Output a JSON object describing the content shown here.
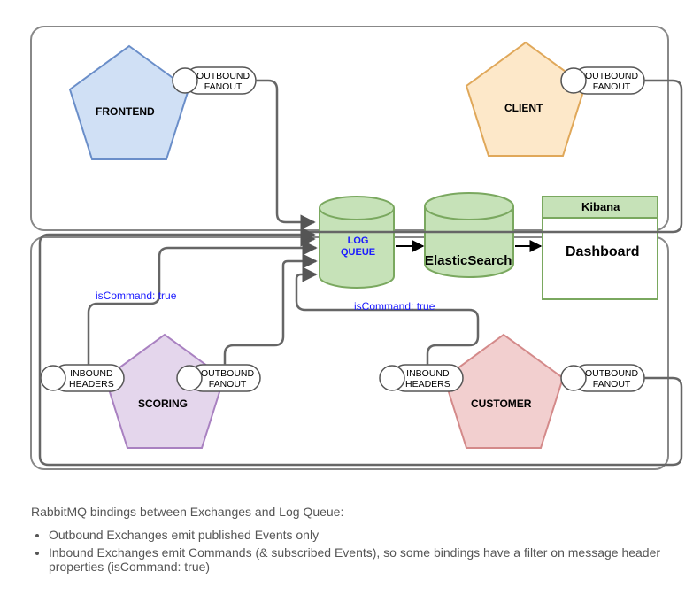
{
  "nodes": {
    "frontend": {
      "label": "FRONTEND",
      "out": "OUTBOUND\nFANOUT"
    },
    "client": {
      "label": "CLIENT",
      "out": "OUTBOUND\nFANOUT"
    },
    "scoring": {
      "label": "SCORING",
      "in": "INBOUND\nHEADERS",
      "out": "OUTBOUND\nFANOUT"
    },
    "customer": {
      "label": "CUSTOMER",
      "in": "INBOUND\nHEADERS",
      "out": "OUTBOUND\nFANOUT"
    },
    "logqueue": "LOG\nQUEUE",
    "elastic": "ElasticSearch",
    "kibana": "Kibana",
    "dashboard": "Dashboard"
  },
  "edge_labels": {
    "scoring_cmd": "isCommand: true",
    "customer_cmd": "isCommand: true"
  },
  "footer": {
    "title": "RabbitMQ bindings between Exchanges and Log Queue:",
    "bullets": [
      "Outbound Exchanges emit published Events only",
      "Inbound Exchanges emit Commands (& subscribed Events), so some bindings have a filter on message header properties (isCommand: true)"
    ]
  }
}
